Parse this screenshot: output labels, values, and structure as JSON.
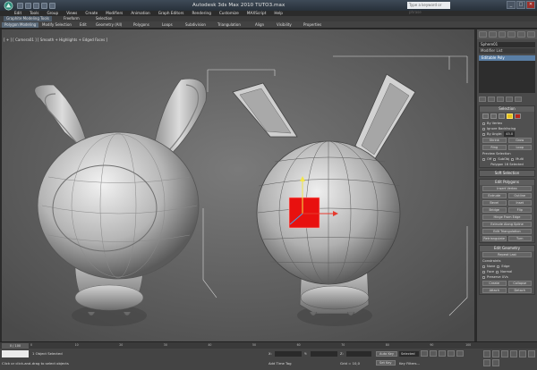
{
  "window": {
    "title": "Autodesk 3ds Max  2010     TUTO3.max",
    "search_placeholder": "Type a keyword or phrase",
    "minimize": "_",
    "maximize": "□",
    "close": "✕"
  },
  "menu": {
    "items": [
      "Edit",
      "Tools",
      "Group",
      "Views",
      "Create",
      "Modifiers",
      "Animation",
      "Graph Editors",
      "Rendering",
      "Customize",
      "MAXScript",
      "Help"
    ]
  },
  "ribbon": {
    "tabs": [
      "Graphite Modeling Tools",
      "Freeform",
      "Selection"
    ],
    "active_tab": 0,
    "buttons": [
      "Polygon Modeling",
      "Modify Selection",
      "Edit",
      "Geometry (All)",
      "Polygons",
      "Loops",
      "Subdivision",
      "Triangulation",
      "Align",
      "Visibility",
      "Properties"
    ],
    "active_button": 0
  },
  "viewport": {
    "label": "[ + ] [ Camera01 ] [ Smooth + Highlights + Edged Faces ]",
    "selection_color": "#e8110f",
    "background": "#5f5f5f"
  },
  "command_panel": {
    "object_name": "Sphere01",
    "modifier_list": "Modifier List",
    "stack_item": "Editable Poly",
    "selection": {
      "header": "Selection",
      "by_vertex": "By Vertex",
      "ignore_backfacing": "Ignore Backfacing",
      "by_angle": "By Angle:",
      "by_angle_value": "45.0",
      "shrink": "Shrink",
      "grow": "Grow",
      "ring": "Ring",
      "loop": "Loop",
      "preview_selection": "Preview Selection",
      "off": "Off",
      "subobj": "SubObj",
      "multi": "Multi",
      "status": "Polygon 16 Selected"
    },
    "soft_selection": {
      "header": "Soft Selection"
    },
    "edit_polygons": {
      "header": "Edit Polygons",
      "insert_vertex": "Insert Vertex",
      "extrude": "Extrude",
      "outline": "Outline",
      "bevel": "Bevel",
      "inset": "Inset",
      "bridge": "Bridge",
      "flip": "Flip",
      "hinge": "Hinge From Edge",
      "extrude_spline": "Extrude Along Spline",
      "edit_triangulation": "Edit Triangulation",
      "retriangulate": "Retriangulate",
      "turn": "Turn"
    },
    "edit_geometry": {
      "header": "Edit Geometry",
      "repeat_last": "Repeat Last",
      "constraints": "Constraints",
      "none": "None",
      "edge": "Edge",
      "face": "Face",
      "normal": "Normal",
      "preserve_uvs": "Preserve UVs",
      "create": "Create",
      "collapse": "Collapse",
      "attach": "Attach",
      "detach": "Detach"
    }
  },
  "trackbar": {
    "time_slider": "0 / 100",
    "ticks": [
      "0",
      "10",
      "20",
      "30",
      "40",
      "50",
      "60",
      "70",
      "80",
      "90",
      "100"
    ]
  },
  "status": {
    "selected": "1 Object Selected",
    "prompt": "Click or click-and-drag to select objects",
    "x_label": "X:",
    "y_label": "Y:",
    "z_label": "Z:",
    "grid": "Grid = 10,0",
    "auto_key": "Auto Key",
    "selected_dropdown": "Selected",
    "set_key": "Set Key",
    "key_filters": "Key Filters...",
    "add_time_tag": "Add Time Tag"
  }
}
